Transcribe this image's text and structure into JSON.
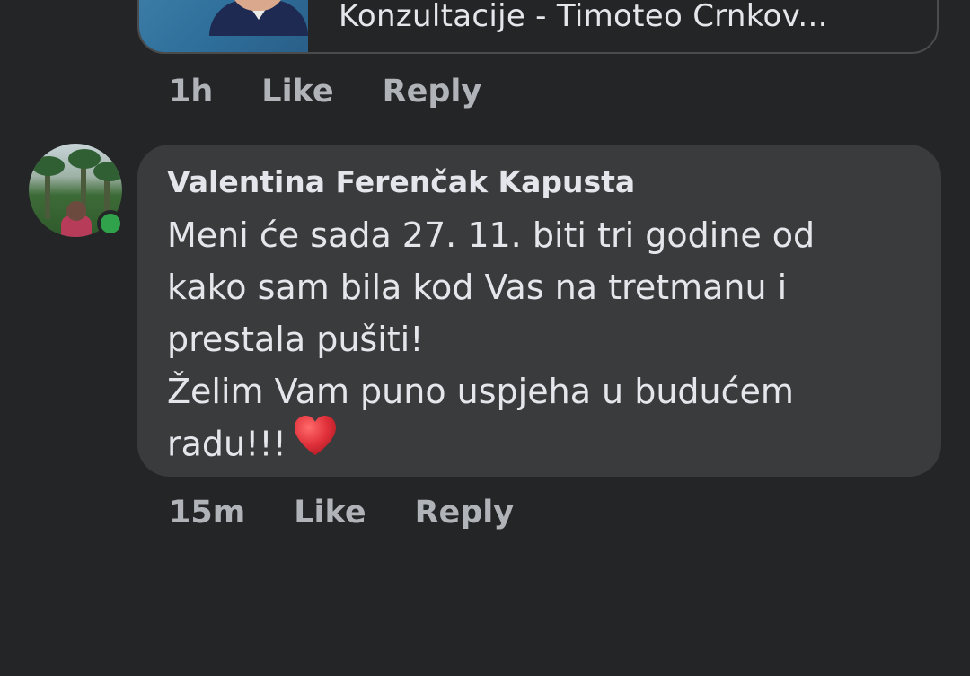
{
  "link_preview": {
    "title": "Konzultacije - Timoteo Crnkov..."
  },
  "first_comment_actions": {
    "time": "1h",
    "like": "Like",
    "reply": "Reply"
  },
  "comment": {
    "author": "Valentina Ferenčak Kapusta",
    "lines": [
      "Meni će sada 27. 11. biti tri godine od",
      "kako sam bila kod Vas na tretmanu i",
      "prestala pušiti!",
      "Želim Vam puno uspjeha u budućem",
      "radu!!!"
    ],
    "emoji_icon": "red-heart-icon",
    "online_status": "online",
    "actions": {
      "time": "15m",
      "like": "Like",
      "reply": "Reply"
    }
  },
  "colors": {
    "background": "#242526",
    "bubble": "#3a3b3c",
    "text_primary": "#e4e6eb",
    "text_secondary": "#b0b3b8",
    "online": "#31a24c",
    "heart": "#e0303a"
  }
}
